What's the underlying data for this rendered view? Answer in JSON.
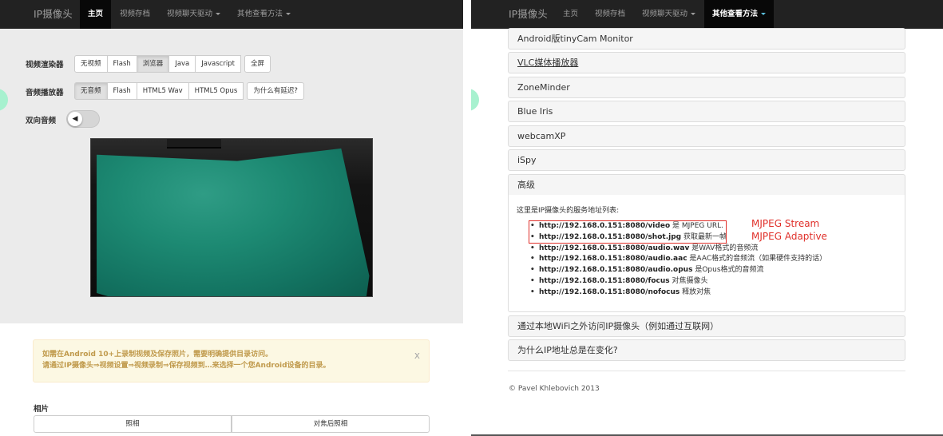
{
  "left": {
    "brand": "IP摄像头",
    "nav": [
      {
        "label": "主页",
        "active": true
      },
      {
        "label": "视频存档"
      },
      {
        "label": "视频聊天驱动"
      },
      {
        "label": "其他查看方法"
      }
    ],
    "video_renderer": {
      "label": "视频渲染器",
      "options": [
        "无视频",
        "Flash",
        "浏览器",
        "Java",
        "Javascript"
      ],
      "active": "浏览器",
      "fullscreen": "全屏"
    },
    "audio_player": {
      "label": "音频播放器",
      "options": [
        "无音频",
        "Flash",
        "HTML5 Wav",
        "HTML5 Opus"
      ],
      "active": "无音频",
      "why_delay": "为什么有延迟?"
    },
    "two_way_audio": {
      "label": "双向音频",
      "enabled": false
    },
    "alert": {
      "line1": "如需在Android 10+上录制视频及保存照片，需要明确提供目录访问。",
      "line2": "请通过IP摄像头⇒视频设置⇒视频录制⇒保存视频到…来选择一个您Android设备的目录。",
      "close": "x"
    },
    "photo": {
      "title": "相片",
      "take": "照相",
      "focus_take": "对焦后照相"
    }
  },
  "right": {
    "brand": "IP摄像头",
    "nav": [
      {
        "label": "主页"
      },
      {
        "label": "视频存档"
      },
      {
        "label": "视频聊天驱动"
      },
      {
        "label": "其他查看方法",
        "active": true
      }
    ],
    "accordion": [
      "Android版tinyCam Monitor",
      "VLC媒体播放器",
      "ZoneMinder",
      "Blue Iris",
      "webcamXP",
      "iSpy",
      "高级"
    ],
    "advanced": {
      "intro": "这里是IP摄像头的服务地址列表:",
      "urls": [
        {
          "url": "http://192.168.0.151:8080/video",
          "desc": "是 MJPEG URL."
        },
        {
          "url": "http://192.168.0.151:8080/shot.jpg",
          "desc": "获取最新一帧"
        },
        {
          "url": "http://192.168.0.151:8080/audio.wav",
          "desc": "是WAV格式的音频流"
        },
        {
          "url": "http://192.168.0.151:8080/audio.aac",
          "desc": "是AAC格式的音频流（如果硬件支持的话）"
        },
        {
          "url": "http://192.168.0.151:8080/audio.opus",
          "desc": "是Opus格式的音频流"
        },
        {
          "url": "http://192.168.0.151:8080/focus",
          "desc": "对焦摄像头"
        },
        {
          "url": "http://192.168.0.151:8080/nofocus",
          "desc": "释放对焦"
        }
      ],
      "annotation_stream": "MJPEG Stream",
      "annotation_adaptive": "MJPEG Adaptive"
    },
    "accordion_after": [
      "通过本地WiFi之外访问IP摄像头（例如通过互联网）",
      "为什么IP地址总是在变化?"
    ],
    "footer": "© Pavel Khlebovich 2013"
  },
  "colors": {
    "navbar": "#222222",
    "alert_bg": "#fcf8e3",
    "alert_text": "#c09a4c",
    "annotation_red": "#e0302a",
    "side_tab": "#a7f1cf"
  }
}
